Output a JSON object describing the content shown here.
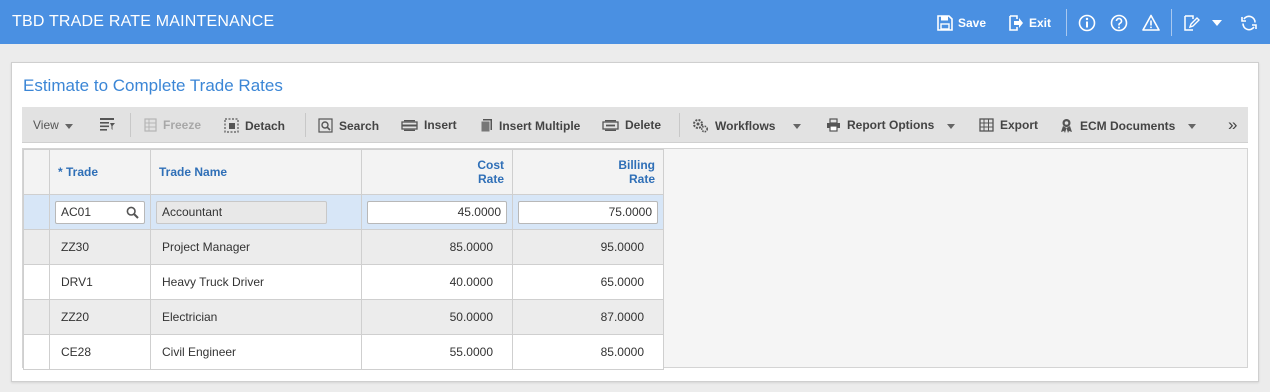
{
  "app": {
    "title": "TBD TRADE RATE MAINTENANCE",
    "save_label": "Save",
    "exit_label": "Exit"
  },
  "icons": {
    "save": "save-icon",
    "exit": "exit-icon",
    "info": "info-icon",
    "help": "help-icon",
    "warning": "warning-icon",
    "notes": "edit-note-icon",
    "refresh": "refresh-icon"
  },
  "panel": {
    "title": "Estimate to Complete Trade Rates"
  },
  "toolbar": {
    "view": "View",
    "freeze": "Freeze",
    "detach": "Detach",
    "search": "Search",
    "insert": "Insert",
    "insert_multiple": "Insert Multiple",
    "delete": "Delete",
    "workflows": "Workflows",
    "report_options": "Report Options",
    "export": "Export",
    "ecm_documents": "ECM Documents",
    "more": "»"
  },
  "grid": {
    "headers": {
      "trade": "* Trade",
      "trade_name": "Trade Name",
      "cost_rate_1": "Cost",
      "cost_rate_2": "Rate",
      "billing_rate_1": "Billing",
      "billing_rate_2": "Rate"
    },
    "edit_row": {
      "trade": "AC01",
      "trade_name": "Accountant",
      "cost_rate": "45.0000",
      "billing_rate": "75.0000"
    },
    "rows": [
      {
        "trade": "ZZ30",
        "trade_name": "Project Manager",
        "cost_rate": "85.0000",
        "billing_rate": "95.0000"
      },
      {
        "trade": "DRV1",
        "trade_name": "Heavy Truck Driver",
        "cost_rate": "40.0000",
        "billing_rate": "65.0000"
      },
      {
        "trade": "ZZ20",
        "trade_name": "Electrician",
        "cost_rate": "50.0000",
        "billing_rate": "87.0000"
      },
      {
        "trade": "CE28",
        "trade_name": "Civil Engineer",
        "cost_rate": "55.0000",
        "billing_rate": "85.0000"
      }
    ]
  },
  "colors": {
    "titlebar": "#4a90e2",
    "panel_title": "#3b86d6",
    "header_text": "#2f6fb7",
    "selected_row": "#d7e6f7"
  }
}
